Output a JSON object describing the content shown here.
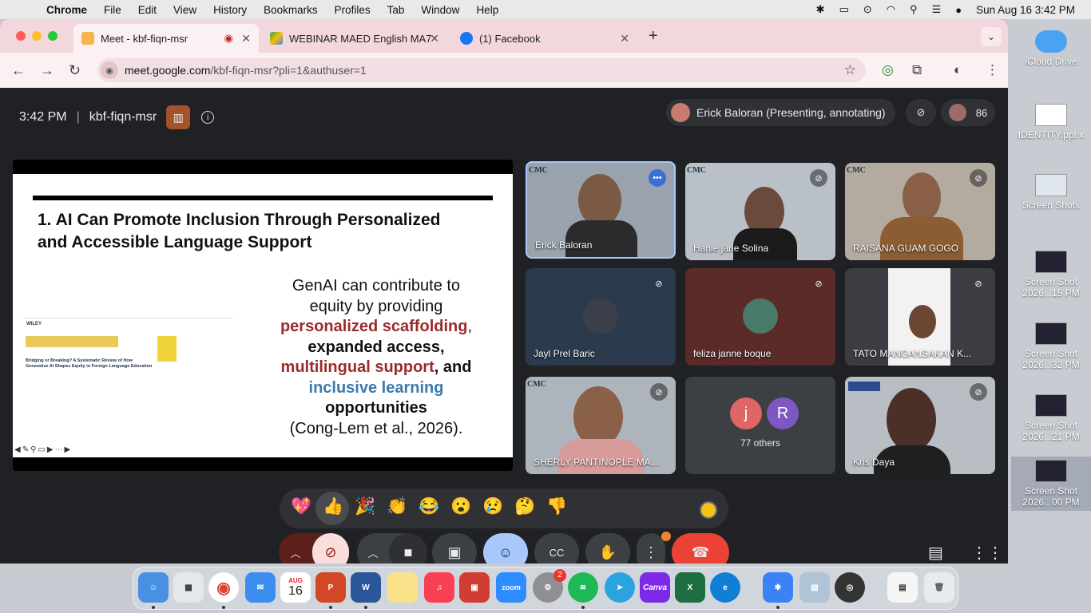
{
  "menubar": {
    "app": "Chrome",
    "items": [
      "File",
      "Edit",
      "View",
      "History",
      "Bookmarks",
      "Profiles",
      "Tab",
      "Window",
      "Help"
    ],
    "clock": "Sun Aug 16  3:42 PM"
  },
  "tabs": [
    {
      "title": "Meet - kbf-fiqn-msr",
      "active": true
    },
    {
      "title": "WEBINAR MAED English MA7",
      "active": false
    },
    {
      "title": "(1) Facebook",
      "active": false
    }
  ],
  "omnibox": {
    "host": "meet.google.com",
    "path": "/kbf-fiqn-msr?pli=1&authuser=1"
  },
  "meet": {
    "time": "3:42 PM",
    "code": "kbf-fiqn-msr",
    "presenter_label": "Erick Baloran (Presenting, annotating)",
    "participant_count": "86"
  },
  "slide": {
    "title_line1": "1. AI Can Promote Inclusion Through Personalized",
    "title_line2": "and Accessible Language Support",
    "body_1": "GenAI can contribute to",
    "body_2": "equity by providing",
    "hl_1": "personalized scaffolding",
    "comma_1": ",",
    "body_3": "expanded access,",
    "hl_2": "multilingual support",
    "body_4": ", and",
    "hl_3": "inclusive learning",
    "body_5": "opportunities",
    "body_6": "(Cong-Lem et al., 2026).",
    "paper_title": "Bridging or Breaking? A Systematic Review of How Generative AI Shapes Equity in Foreign Language Education"
  },
  "tiles": [
    {
      "name": "Erick Baloran",
      "speaking": true
    },
    {
      "name": "Hanie jane Solina",
      "muted": true
    },
    {
      "name": "RAISANA GUAM GOGO",
      "muted": true
    },
    {
      "name": "Jayl Prel Baric",
      "muted": true
    },
    {
      "name": "feliza janne boque",
      "muted": true
    },
    {
      "name": "TATO MANGANSAKAN K...",
      "muted": true
    },
    {
      "name": "SHERLY PANTINOPLE MA...",
      "muted": true
    },
    {
      "name": "77 others",
      "initials": [
        "j",
        "R"
      ]
    },
    {
      "name": "Kris Daya",
      "muted": true
    }
  ],
  "reactions": [
    "💖",
    "👍",
    "🎉",
    "👏",
    "😂",
    "😮",
    "😢",
    "🤔",
    "👎"
  ],
  "dock": {
    "calendar_month": "AUG",
    "calendar_day": "16",
    "settings_badge": "2"
  },
  "desktop": [
    {
      "label": "iCloud Drive"
    },
    {
      "label": "IDENTITY.ppt x"
    },
    {
      "label": "Screen Shots"
    },
    {
      "label": "Screen Shot 2026...15 PM"
    },
    {
      "label": "Screen Shot 2026...32 PM"
    },
    {
      "label": "Screen Shot 2026...21 PM"
    },
    {
      "label": "Screen Shot 2026...00 PM"
    }
  ],
  "colors": {
    "leave_red": "#ea4335",
    "mic_off": "#f9dedc",
    "accent_blue": "#a8c7fa",
    "tab_bar": "#f2d7dc"
  }
}
